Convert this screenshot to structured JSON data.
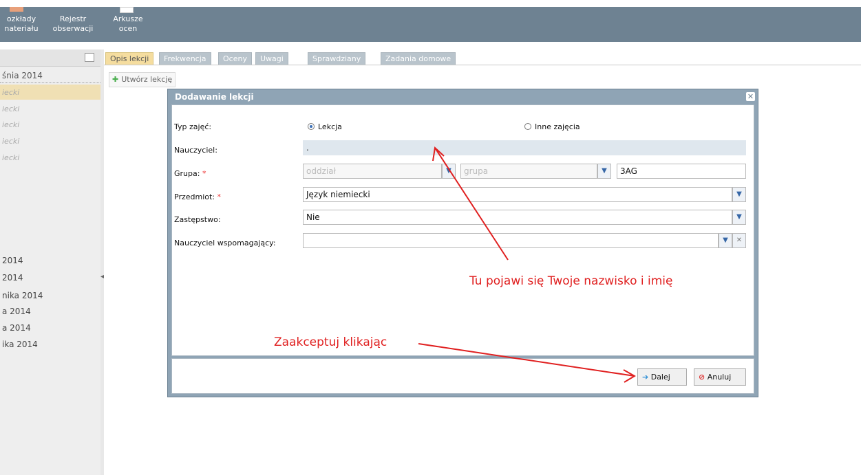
{
  "toolbar": {
    "items": [
      {
        "label": "Rozkłady materiału",
        "line1": "ozkłady",
        "line2": "nateriału"
      },
      {
        "label": "Rejestr obserwacji",
        "line1": "Rejestr",
        "line2": "obserwacji"
      },
      {
        "label": "Arkusze ocen",
        "line1": "Arkusze",
        "line2": "ocen"
      }
    ]
  },
  "sidebar": {
    "date_top": "śnia 2014",
    "lessons": [
      "iecki",
      "iecki",
      "iecki",
      "iecki",
      "iecki"
    ],
    "dates": [
      "2014",
      " 2014",
      "nika 2014",
      "a 2014",
      "a 2014",
      "ika 2014"
    ]
  },
  "tabs": [
    "Opis lekcji",
    "Frekwencja",
    "Oceny",
    "Uwagi",
    "Sprawdziany",
    "Zadania domowe"
  ],
  "create_button": "Utwórz lekcję",
  "dialog": {
    "title": "Dodawanie lekcji",
    "fields": {
      "typ_label": "Typ zajęć:",
      "typ_option1": "Lekcja",
      "typ_option2": "Inne zajęcia",
      "nauczyciel_label": "Nauczyciel:",
      "nauczyciel_value": ".",
      "grupa_label": "Grupa:",
      "grupa_oddzial_placeholder": "oddział",
      "grupa_grupa_placeholder": "grupa",
      "grupa_value": "3AG",
      "przedmiot_label": "Przedmiot:",
      "przedmiot_value": "Język niemiecki",
      "zastepstwo_label": "Zastępstwo:",
      "zastepstwo_value": "Nie",
      "wspomagajacy_label": "Nauczyciel wspomagający:",
      "wspomagajacy_value": ""
    },
    "buttons": {
      "next": "Dalej",
      "cancel": "Anuluj"
    }
  },
  "annotations": {
    "name_note": "Tu pojawi się Twoje nazwisko i imię",
    "accept_note": "Zaakceptuj klikając"
  },
  "colors": {
    "toolbar": "#6e8292",
    "dialog_frame": "#8fa4b5",
    "active_tab": "#f5dd9f",
    "annotation": "#e02020",
    "required": "#e33333"
  }
}
